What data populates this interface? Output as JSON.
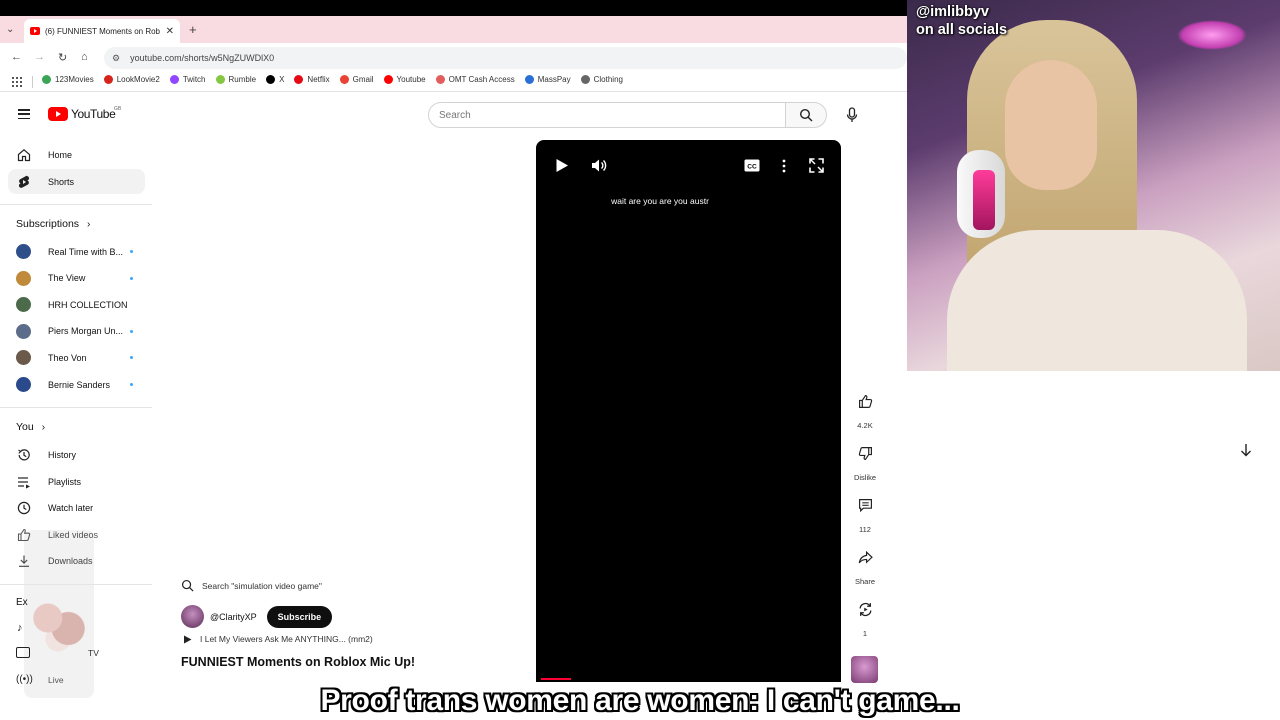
{
  "browser": {
    "tab_title": "(6) FUNNIEST Moments on Rob",
    "url": "youtube.com/shorts/w5NgZUWDlX0",
    "bookmarks": [
      {
        "label": "123Movies",
        "color": "#3aa655"
      },
      {
        "label": "LookMovie2",
        "color": "#d6241c"
      },
      {
        "label": "Twitch",
        "color": "#9146ff"
      },
      {
        "label": "Rumble",
        "color": "#85c742"
      },
      {
        "label": "X",
        "color": "#000000"
      },
      {
        "label": "Netflix",
        "color": "#e50914"
      },
      {
        "label": "Gmail",
        "color": "#ea4335"
      },
      {
        "label": "Youtube",
        "color": "#ff0000"
      },
      {
        "label": "OMT Cash Access",
        "color": "#e35d5d"
      },
      {
        "label": "MassPay",
        "color": "#2a6fd6"
      },
      {
        "label": "Clothing",
        "color": "#666666"
      }
    ]
  },
  "youtube": {
    "logo_text": "YouTube",
    "logo_country": "GB",
    "search_placeholder": "Search"
  },
  "sidebar": {
    "home": "Home",
    "shorts": "Shorts",
    "subscriptions_heading": "Subscriptions",
    "subscriptions": [
      {
        "label": "Real Time with B...",
        "dot": true,
        "color": "#2e4f8a"
      },
      {
        "label": "The View",
        "dot": true,
        "color": "#c08a3b"
      },
      {
        "label": "HRH COLLECTION",
        "dot": false,
        "color": "#4b6b4b"
      },
      {
        "label": "Piers Morgan Un...",
        "dot": true,
        "color": "#5b6d8a"
      },
      {
        "label": "Theo Von",
        "dot": true,
        "color": "#6b5a4a"
      },
      {
        "label": "Bernie Sanders",
        "dot": true,
        "color": "#2b4a8b"
      }
    ],
    "you_heading": "You",
    "you_items": [
      "History",
      "Playlists",
      "Watch later",
      "Liked videos",
      "Downloads"
    ],
    "explore_partial": "Ex",
    "partial_tv": "TV",
    "partial_live": "Live"
  },
  "short": {
    "search_hint": "Search \"simulation video game\"",
    "channel": "@ClarityXP",
    "subscribe": "Subscribe",
    "playlist": "I Let My Viewers Ask Me ANYTHING... (mm2)",
    "title": "FUNNIEST Moments on Roblox Mic Up!",
    "caption": "wait are you are you austr",
    "progress": 0.1
  },
  "actions": {
    "likes": "4.2K",
    "dislike": "Dislike",
    "comments": "112",
    "share": "Share",
    "remix": "1"
  },
  "overlay": {
    "handle": "@imlibbyv",
    "socials": "on all socials",
    "subtitle": "Proof trans women are women: I can't game..."
  }
}
